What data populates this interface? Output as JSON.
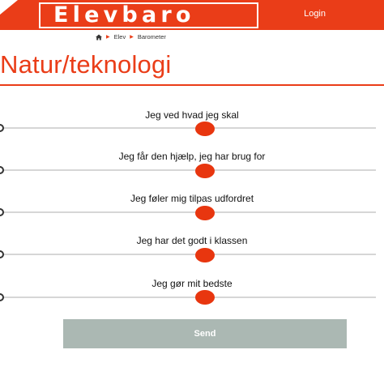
{
  "header": {
    "logo_text": "Elevbaro",
    "login_label": "Login",
    "accent_color": "#ea3d18"
  },
  "breadcrumb": {
    "home_icon": "home-icon",
    "items": [
      "Elev",
      "Barometer"
    ]
  },
  "page": {
    "title": "Natur/teknologi"
  },
  "questions": [
    {
      "label": "Jeg ved hvad jeg skal"
    },
    {
      "label": "Jeg får den hjælp, jeg har brug for"
    },
    {
      "label": "Jeg føler mig tilpas udfordret"
    },
    {
      "label": "Jeg har det godt i klassen"
    },
    {
      "label": "Jeg gør mit bedste"
    }
  ],
  "form": {
    "send_label": "Send",
    "send_color": "#abb8b3"
  }
}
